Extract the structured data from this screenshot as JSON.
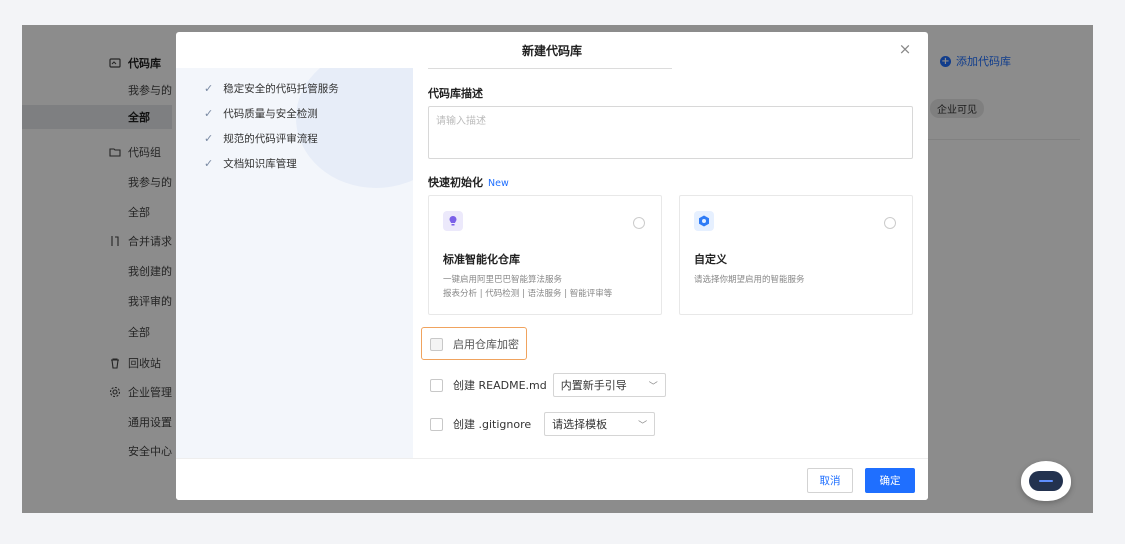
{
  "sidebar": {
    "items": [
      {
        "label": "代码库",
        "level": "section",
        "icon": "repo-icon",
        "bold": true
      },
      {
        "label": "我参与的",
        "level": "sub"
      },
      {
        "label": "全部",
        "level": "sub",
        "active": true,
        "bold": true
      },
      {
        "label": "代码组",
        "level": "section",
        "icon": "folder-icon"
      },
      {
        "label": "我参与的",
        "level": "sub"
      },
      {
        "label": "全部",
        "level": "sub"
      },
      {
        "label": "合并请求",
        "level": "section",
        "icon": "merge-request-icon"
      },
      {
        "label": "我创建的",
        "level": "sub"
      },
      {
        "label": "我评审的",
        "level": "sub"
      },
      {
        "label": "全部",
        "level": "sub"
      },
      {
        "label": "回收站",
        "level": "section",
        "icon": "trash-icon"
      },
      {
        "label": "企业管理",
        "level": "section",
        "icon": "gear-icon"
      },
      {
        "label": "通用设置",
        "level": "sub"
      },
      {
        "label": "安全中心",
        "level": "sub"
      }
    ]
  },
  "right_panel": {
    "add_repo_label": "添加代码库",
    "enterprise_badge": "企业可见"
  },
  "modal": {
    "title": "新建代码库",
    "features": [
      "稳定安全的代码托管服务",
      "代码质量与安全检测",
      "规范的代码评审流程",
      "文档知识库管理"
    ],
    "description_label": "代码库描述",
    "description_placeholder": "请输入描述",
    "quick_init_label": "快速初始化",
    "quick_init_new_tag": "New",
    "cards": [
      {
        "title": "标准智能化仓库",
        "desc_line1": "一键启用阿里巴巴智能算法服务",
        "desc_line2": "报表分析 | 代码检测 | 语法服务 | 智能评审等",
        "icon": "lightbulb-icon",
        "icon_bg": "#ece9fb",
        "icon_color": "#7b61e8"
      },
      {
        "title": "自定义",
        "desc_line1": "请选择你期望启用的智能服务",
        "icon": "hexagon-icon",
        "icon_bg": "#e6f0ff",
        "icon_color": "#2f7cf6"
      }
    ],
    "encrypt_label": "启用仓库加密",
    "readme_label": "创建 README.md",
    "readme_select_value": "内置新手引导",
    "gitignore_label": "创建 .gitignore",
    "gitignore_select_value": "请选择模板",
    "cancel_label": "取消",
    "confirm_label": "确定"
  },
  "colors": {
    "primary": "#1f6fff",
    "highlight_border": "#f0a35e"
  }
}
